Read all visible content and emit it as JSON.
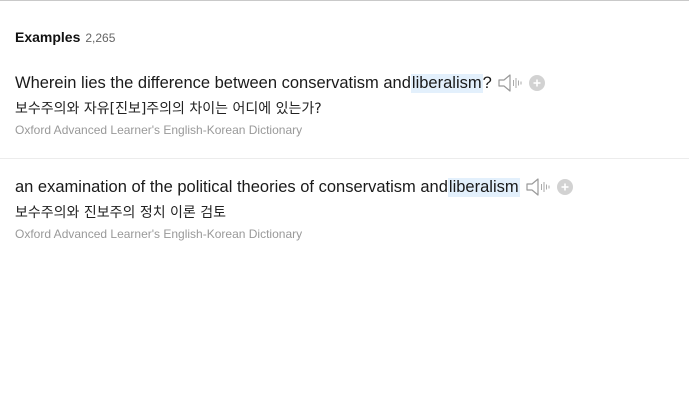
{
  "header": {
    "title": "Examples",
    "count": "2,265"
  },
  "examples": [
    {
      "en_before": "Wherein lies the difference between conservatism and ",
      "en_highlight": "liberalism",
      "en_after": "?",
      "ko": "보수주의와 자유[진보]주의의 차이는 어디에 있는가?",
      "source": "Oxford Advanced Learner's English-Korean Dictionary"
    },
    {
      "en_before": "an examination of the political theories of conservatism and ",
      "en_highlight": "liberalism",
      "en_after": "",
      "ko": "보수주의와 진보주의 정치 이론 검토",
      "source": "Oxford Advanced Learner's English-Korean Dictionary"
    }
  ],
  "icons": {
    "speaker": "speaker-icon",
    "add": "plus-circle-icon"
  },
  "colors": {
    "highlight": "#e3f0fc",
    "source_text": "#999999",
    "icon_gray": "#bbbbbb"
  }
}
